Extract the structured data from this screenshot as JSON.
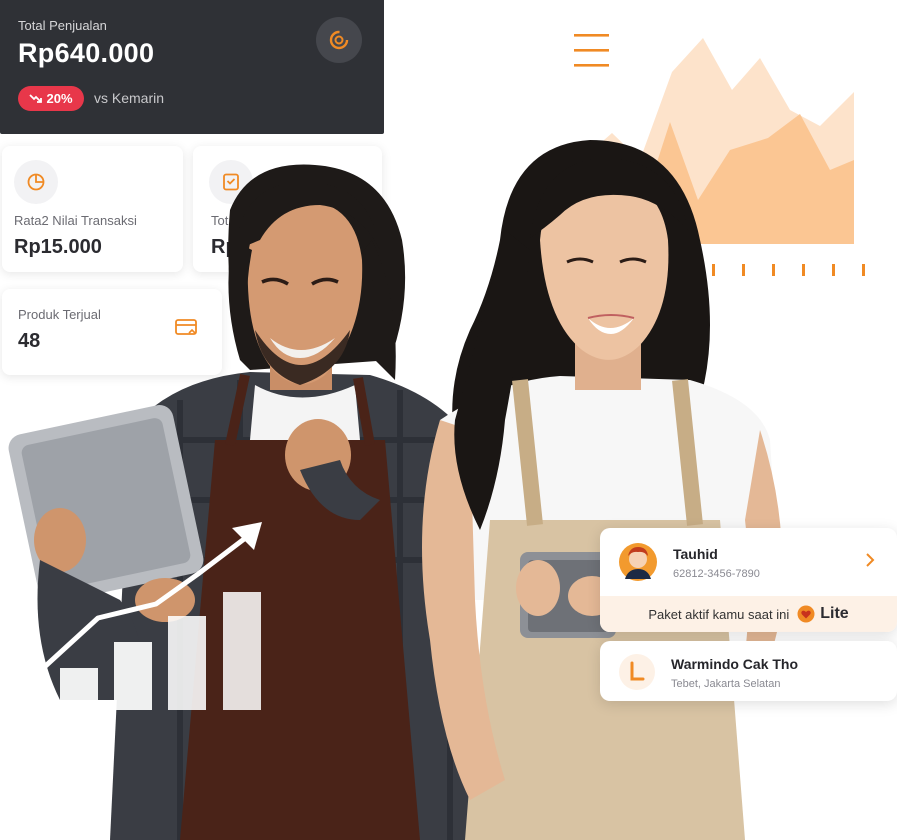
{
  "sales_card": {
    "label": "Total Penjualan",
    "value": "Rp640.000",
    "change": "20%",
    "compare": "vs Kemarin"
  },
  "stat_cards": [
    {
      "label": "Rata2 Nilai Transaksi",
      "value": "Rp15.000"
    },
    {
      "label": "Tot",
      "value": "Rp"
    },
    {
      "label": "Produk Terjual",
      "value": "48"
    }
  ],
  "profile": {
    "name": "Tauhid",
    "phone": "62812-3456-7890",
    "plan_text": "Paket aktif kamu saat ini",
    "plan_name": "Lite"
  },
  "store": {
    "name": "Warmindo Cak Tho",
    "location": "Tebet, Jakarta Selatan"
  },
  "colors": {
    "accent_orange": "#f08a24",
    "chart_light": "#fde3cb",
    "chart_mid": "#fbc693",
    "badge_red": "#e8374a",
    "dark_card": "#2f3136"
  }
}
